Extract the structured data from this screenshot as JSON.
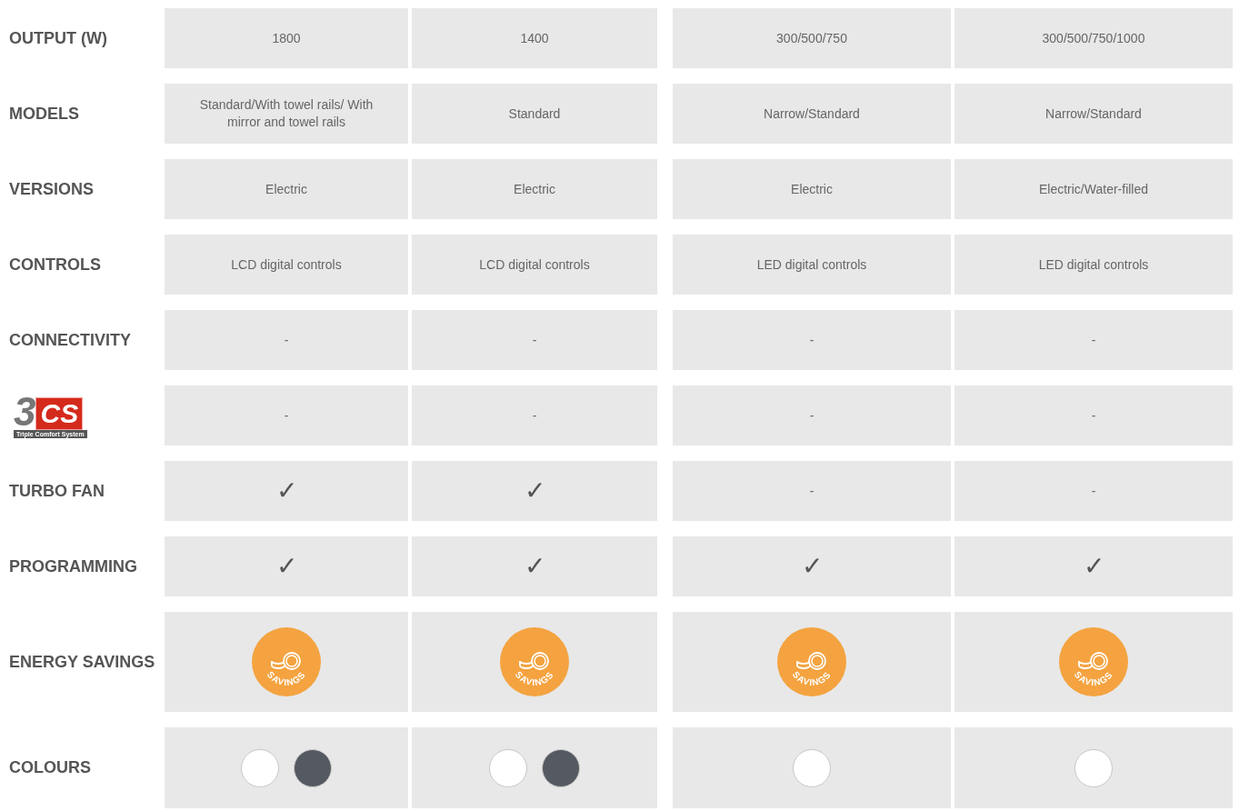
{
  "rows": [
    {
      "label": {
        "kind": "text",
        "text": "OUTPUT (W)"
      },
      "cells": [
        {
          "kind": "text",
          "text": "1800"
        },
        {
          "kind": "text",
          "text": "1400"
        },
        {
          "kind": "text",
          "text": "300/500/750"
        },
        {
          "kind": "text",
          "text": "300/500/750/1000"
        }
      ]
    },
    {
      "label": {
        "kind": "text",
        "text": "MODELS"
      },
      "cells": [
        {
          "kind": "text",
          "text": "Standard/With towel rails/ With mirror and towel rails"
        },
        {
          "kind": "text",
          "text": "Standard"
        },
        {
          "kind": "text",
          "text": "Narrow/Standard"
        },
        {
          "kind": "text",
          "text": "Narrow/Standard"
        }
      ]
    },
    {
      "label": {
        "kind": "text",
        "text": "VERSIONS"
      },
      "cells": [
        {
          "kind": "text",
          "text": "Electric"
        },
        {
          "kind": "text",
          "text": "Electric"
        },
        {
          "kind": "text",
          "text": "Electric"
        },
        {
          "kind": "text",
          "text": "Electric/Water-filled"
        }
      ]
    },
    {
      "label": {
        "kind": "text",
        "text": "CONTROLS"
      },
      "cells": [
        {
          "kind": "text",
          "text": "LCD digital controls"
        },
        {
          "kind": "text",
          "text": "LCD digital controls"
        },
        {
          "kind": "text",
          "text": "LED digital controls"
        },
        {
          "kind": "text",
          "text": "LED digital controls"
        }
      ]
    },
    {
      "label": {
        "kind": "text",
        "text": "CONNECTIVITY"
      },
      "cells": [
        {
          "kind": "text",
          "text": "-"
        },
        {
          "kind": "text",
          "text": "-"
        },
        {
          "kind": "text",
          "text": "-"
        },
        {
          "kind": "text",
          "text": "-"
        }
      ]
    },
    {
      "label": {
        "kind": "logo",
        "big": "3",
        "boxed": "CS",
        "caption": "Triple Comfort System"
      },
      "cells": [
        {
          "kind": "text",
          "text": "-"
        },
        {
          "kind": "text",
          "text": "-"
        },
        {
          "kind": "text",
          "text": "-"
        },
        {
          "kind": "text",
          "text": "-"
        }
      ]
    },
    {
      "label": {
        "kind": "text",
        "text": "TURBO FAN"
      },
      "cells": [
        {
          "kind": "mark",
          "text": "✓"
        },
        {
          "kind": "mark",
          "text": "✓"
        },
        {
          "kind": "text",
          "text": "-"
        },
        {
          "kind": "text",
          "text": "-"
        }
      ]
    },
    {
      "label": {
        "kind": "text",
        "text": "PROGRAMMING"
      },
      "cells": [
        {
          "kind": "mark",
          "text": "✓"
        },
        {
          "kind": "mark",
          "text": "✓"
        },
        {
          "kind": "mark",
          "text": "✓"
        },
        {
          "kind": "mark",
          "text": "✓"
        }
      ]
    },
    {
      "label": {
        "kind": "text",
        "text": "ENERGY SAVINGS"
      },
      "cells": [
        {
          "kind": "badge",
          "text": "SAVINGS"
        },
        {
          "kind": "badge",
          "text": "SAVINGS"
        },
        {
          "kind": "badge",
          "text": "SAVINGS"
        },
        {
          "kind": "badge",
          "text": "SAVINGS"
        }
      ]
    },
    {
      "label": {
        "kind": "text",
        "text": "COLOURS"
      },
      "cells": [
        {
          "kind": "swatches",
          "colors": [
            {
              "color": "#ffffff"
            },
            {
              "color": "#555a62"
            }
          ]
        },
        {
          "kind": "swatches",
          "colors": [
            {
              "color": "#ffffff"
            },
            {
              "color": "#555a62"
            }
          ]
        },
        {
          "kind": "swatches",
          "colors": [
            {
              "color": "#ffffff"
            }
          ]
        },
        {
          "kind": "swatches",
          "colors": [
            {
              "color": "#ffffff"
            }
          ]
        }
      ]
    }
  ]
}
